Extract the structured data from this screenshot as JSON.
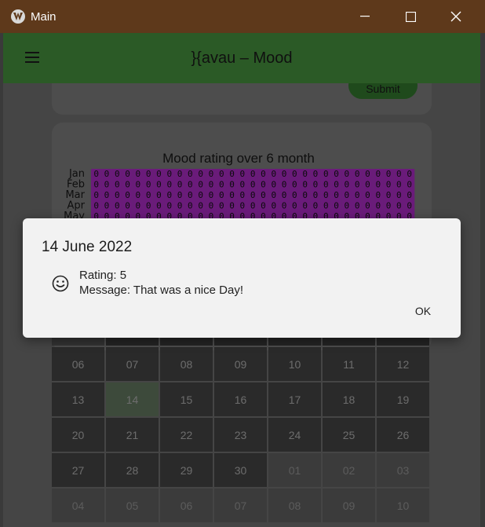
{
  "window": {
    "title": "Main",
    "minimize": "—",
    "maximize": "☐",
    "close": "✕"
  },
  "appbar": {
    "title": "}{avau – Mood"
  },
  "form": {
    "submit_label": "Submit"
  },
  "chart_data": {
    "type": "heatmap",
    "title": "Mood rating over 6 month",
    "y_labels": [
      "Jan",
      "Feb",
      "Mar",
      "Apr",
      "May"
    ],
    "cell_value": "0",
    "columns": 31,
    "colors": {
      "cell": "#6a1b7a",
      "cell_text": "#0b0b0b"
    }
  },
  "calendar": {
    "rows": [
      [
        "06",
        "07",
        "08",
        "09",
        "10",
        "11",
        "12"
      ],
      [
        "13",
        "14",
        "15",
        "16",
        "17",
        "18",
        "19"
      ],
      [
        "20",
        "21",
        "22",
        "23",
        "24",
        "25",
        "26"
      ],
      [
        "27",
        "28",
        "29",
        "30",
        "01",
        "02",
        "03"
      ],
      [
        "04",
        "05",
        "06",
        "07",
        "08",
        "09",
        "10"
      ]
    ],
    "selected_day": "14",
    "current_month_end_index": 3
  },
  "dialog": {
    "title": "14 June 2022",
    "rating": "Rating: 5",
    "message": "Message: That was a nice Day!",
    "ok_label": "OK",
    "icon": "smiley-face-icon"
  }
}
